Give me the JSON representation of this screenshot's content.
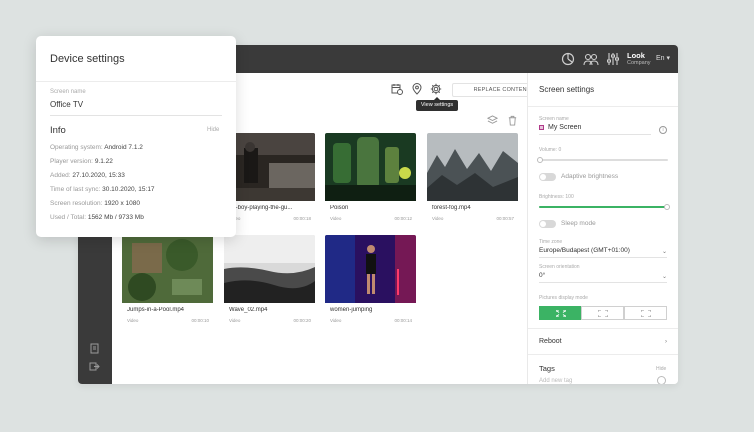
{
  "topbar": {
    "user_name": "Look",
    "user_company": "Company",
    "language": "En",
    "icons": [
      "chart-icon",
      "users-icon",
      "sliders-icon"
    ]
  },
  "toolbar": {
    "replace_label": "REPLACE CONTENT",
    "tooltip": "View settings",
    "icons": [
      "calendar-clock-icon",
      "location-pin-icon",
      "gear-icon",
      "layers-icon",
      "trash-icon"
    ]
  },
  "media": [
    {
      "name": "",
      "type": "",
      "duration": ""
    },
    {
      "name": "en-boy-playing-the-gu...",
      "type": "Video",
      "duration": "00:00:18"
    },
    {
      "name": "Poison",
      "type": "Video",
      "duration": "00:00:12"
    },
    {
      "name": "forest-fog.mp4",
      "type": "Video",
      "duration": "00:00:57"
    },
    {
      "name": "Jumps-in-a-Pool.mp4",
      "type": "Video",
      "duration": "00:00:10"
    },
    {
      "name": "Wave_02.mp4",
      "type": "Video",
      "duration": "00:00:20"
    },
    {
      "name": "women-jumping",
      "type": "Video",
      "duration": "00:00:14"
    }
  ],
  "screen_settings": {
    "title": "Screen settings",
    "screen_name_label": "Screen name",
    "screen_name": "My Screen",
    "volume_label": "Volume: 0",
    "volume": 0,
    "adaptive_brightness": "Adaptive brightness",
    "brightness_label": "Brightness: 100",
    "brightness": 100,
    "sleep_mode": "Sleep mode",
    "time_zone_label": "Time zone",
    "time_zone": "Europe/Budapest (GMT+01:00)",
    "orientation_label": "Screen orientation",
    "orientation": "0°",
    "picture_mode_label": "Pictures display mode",
    "reboot": "Reboot",
    "tags": "Tags",
    "tags_hide": "Hide",
    "add_tag_placeholder": "Add new tag"
  },
  "device_settings": {
    "title": "Device settings",
    "screen_name_label": "Screen name",
    "screen_name": "Office TV",
    "info_title": "Info",
    "hide": "Hide",
    "rows": [
      {
        "label": "Operating system:",
        "value": "Android 7.1.2"
      },
      {
        "label": "Player version:",
        "value": "9.1.22"
      },
      {
        "label": "Added:",
        "value": "27.10.2020, 15:33"
      },
      {
        "label": "Time of last sync:",
        "value": "30.10.2020, 15:17"
      },
      {
        "label": "Screen resolution:",
        "value": "1920 x 1080"
      },
      {
        "label": "Used / Total:",
        "value": "1562 Mb / 9733 Mb"
      }
    ]
  },
  "colors": {
    "accent": "#3bb364",
    "topbar": "#3a3a3a"
  }
}
